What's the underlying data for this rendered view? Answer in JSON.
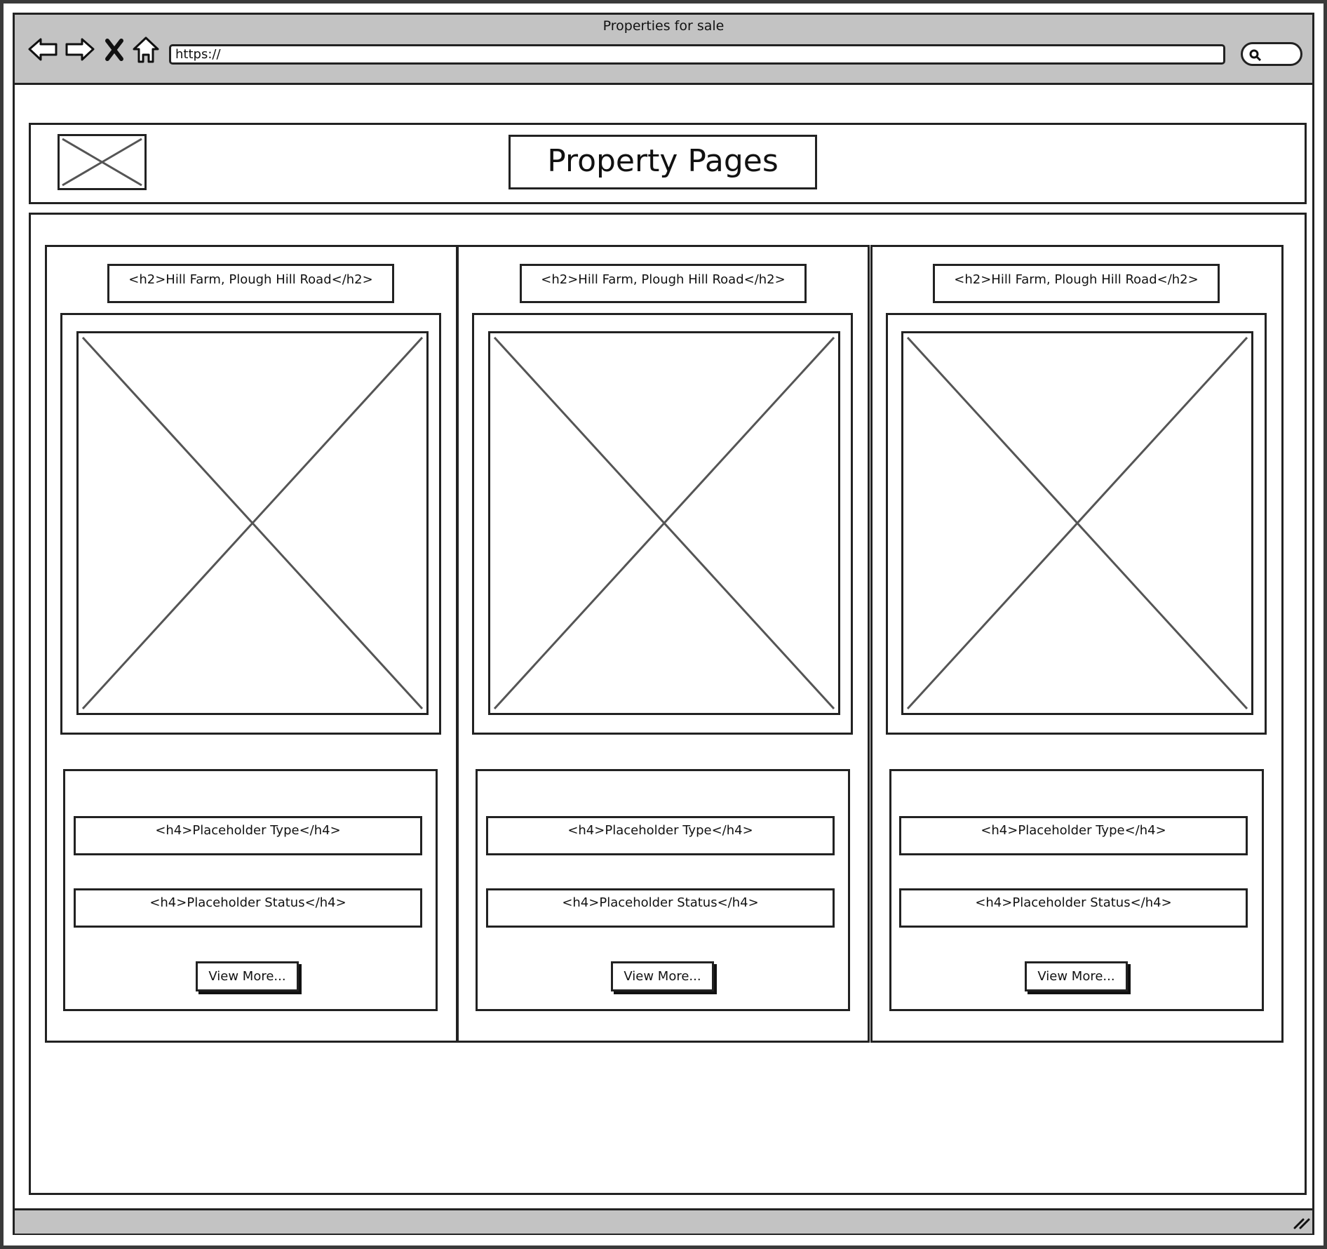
{
  "window": {
    "title": "Properties for sale",
    "address": "https://",
    "icons": [
      "back-arrow-icon",
      "forward-arrow-icon",
      "close-icon",
      "home-icon",
      "search-icon",
      "resize-grip-icon"
    ]
  },
  "header": {
    "logo": "image-placeholder",
    "title": "Property Pages"
  },
  "cards": [
    {
      "heading": "<h2>Hill Farm, Plough Hill Road</h2>",
      "image": "image-placeholder",
      "type": "<h4>Placeholder Type</h4>",
      "status": "<h4>Placeholder Status</h4>",
      "button": "View More..."
    },
    {
      "heading": "<h2>Hill Farm, Plough Hill Road</h2>",
      "image": "image-placeholder",
      "type": "<h4>Placeholder Type</h4>",
      "status": "<h4>Placeholder Status</h4>",
      "button": "View More..."
    },
    {
      "heading": "<h2>Hill Farm, Plough Hill Road</h2>",
      "image": "image-placeholder",
      "type": "<h4>Placeholder Type</h4>",
      "status": "<h4>Placeholder Status</h4>",
      "button": "View More..."
    }
  ]
}
